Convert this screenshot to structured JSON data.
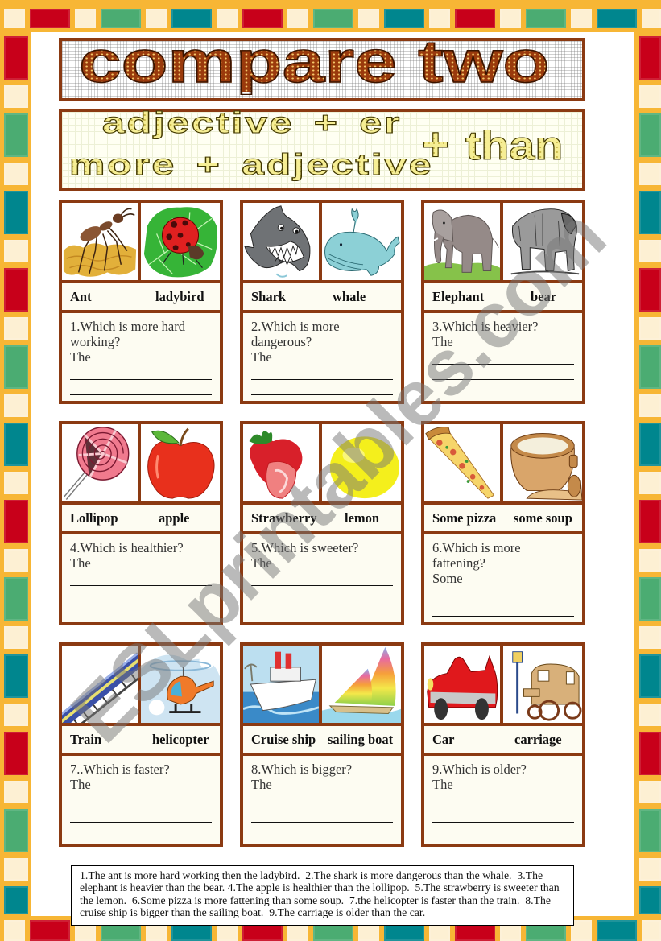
{
  "title": "compare two",
  "subtitle": {
    "line1": "adjective + er",
    "line2": "more + adjective",
    "plus": "+",
    "than": "than"
  },
  "cards": [
    {
      "item_a": "Ant",
      "item_b": "ladybird",
      "images": [
        "ant",
        "ladybird"
      ],
      "question": "1.Which is more hard working?",
      "starter": "The"
    },
    {
      "item_a": "Shark",
      "item_b": "whale",
      "images": [
        "shark",
        "whale"
      ],
      "question": "2.Which is more dangerous?",
      "starter": "The"
    },
    {
      "item_a": "Elephant",
      "item_b": "bear",
      "images": [
        "elephant",
        "bear"
      ],
      "question": "3.Which is heavier?",
      "starter": "The"
    },
    {
      "item_a": "Lollipop",
      "item_b": "apple",
      "images": [
        "lollipop",
        "apple"
      ],
      "question": "4.Which is healthier?",
      "starter": "The"
    },
    {
      "item_a": "Strawberry",
      "item_b": "lemon",
      "images": [
        "strawberry",
        "lemon"
      ],
      "question": "5.Which is sweeter?",
      "starter": "The"
    },
    {
      "item_a": "Some pizza",
      "item_b": "some soup",
      "images": [
        "pizza",
        "soup-pot"
      ],
      "question": "6.Which is more fattening?",
      "starter": "Some"
    },
    {
      "item_a": "Train",
      "item_b": "helicopter",
      "images": [
        "train",
        "helicopter"
      ],
      "question": "7..Which is faster?",
      "starter": "The"
    },
    {
      "item_a": "Cruise ship",
      "item_b": "sailing boat",
      "images": [
        "cruise-ship",
        "sailing-boat"
      ],
      "question": "8.Which is bigger?",
      "starter": "The"
    },
    {
      "item_a": "Car",
      "item_b": "carriage",
      "images": [
        "car",
        "carriage"
      ],
      "question": "9.Which is older?",
      "starter": "The"
    }
  ],
  "answer_key": "1.The ant is more hard working then the ladybird.  2.The shark is more dangerous than the whale.  3.The elephant is heavier than the bear. 4.The apple is healthier than the lollipop.  5.The strawberry is sweeter than the lemon.  6.Some pizza is more fattening than some soup.  7.the helicopter is faster than the train.  8.The cruise ship is bigger than the sailing boat.  9.The carriage is older than the car.",
  "watermark": "ESLprintables.com",
  "colors": {
    "brown": "#8b3a12",
    "title-fill": "#9a3a0c",
    "sub-fill": "#f6ee94",
    "frame": "#f7b635",
    "cell": "#fdfcf2"
  },
  "border": {
    "tile_colors": {
      "red": "#c8001a",
      "cream": "#fdf0d3",
      "green": "#4bac72",
      "teal": "#00868e"
    },
    "horizontal_sequence": [
      "cream",
      "red",
      "cream",
      "green",
      "cream",
      "teal"
    ],
    "vertical_sequence": [
      "red",
      "cream",
      "green",
      "cream",
      "teal",
      "cream"
    ]
  }
}
